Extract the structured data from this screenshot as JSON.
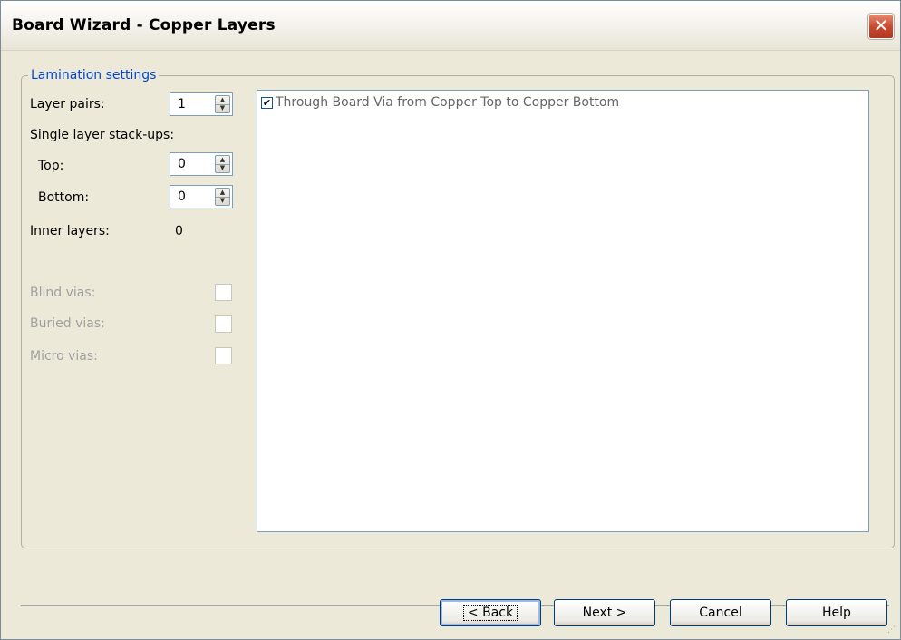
{
  "window": {
    "title": "Board Wizard - Copper Layers",
    "close_symbol": "✕"
  },
  "lamination": {
    "legend": "Lamination settings",
    "layer_pairs_label": "Layer pairs:",
    "layer_pairs_value": "1",
    "single_stackups_label": "Single layer stack-ups:",
    "top_label": "Top:",
    "top_value": "0",
    "bottom_label": "Bottom:",
    "bottom_value": "0",
    "inner_layers_label": "Inner layers:",
    "inner_layers_value": "0",
    "blind_vias_label": "Blind vias:",
    "buried_vias_label": "Buried vias:",
    "micro_vias_label": "Micro vias:"
  },
  "via_list": {
    "items": [
      {
        "label": "Through Board Via from Copper Top to Copper Bottom",
        "checked": true
      }
    ]
  },
  "buttons": {
    "back": "< Back",
    "next": "Next >",
    "cancel": "Cancel",
    "help": "Help"
  }
}
